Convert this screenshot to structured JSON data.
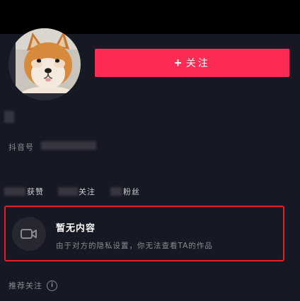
{
  "header": {
    "follow_button_label": "关注",
    "follow_button_icon": "plus-icon"
  },
  "profile": {
    "douyin_id_label": "抖音号"
  },
  "stats": {
    "likes_label": "获赞",
    "following_label": "关注",
    "followers_label": "粉丝"
  },
  "empty_state": {
    "title": "暂无内容",
    "description": "由于对方的隐私设置，你无法查看TA的作品",
    "icon": "video-camera-icon"
  },
  "recommend": {
    "label": "推荐关注",
    "icon": "info-icon"
  },
  "colors": {
    "background": "#161823",
    "accent": "#fe2c55",
    "highlight_border": "#e11f27",
    "muted_text": "#8a8b91"
  }
}
